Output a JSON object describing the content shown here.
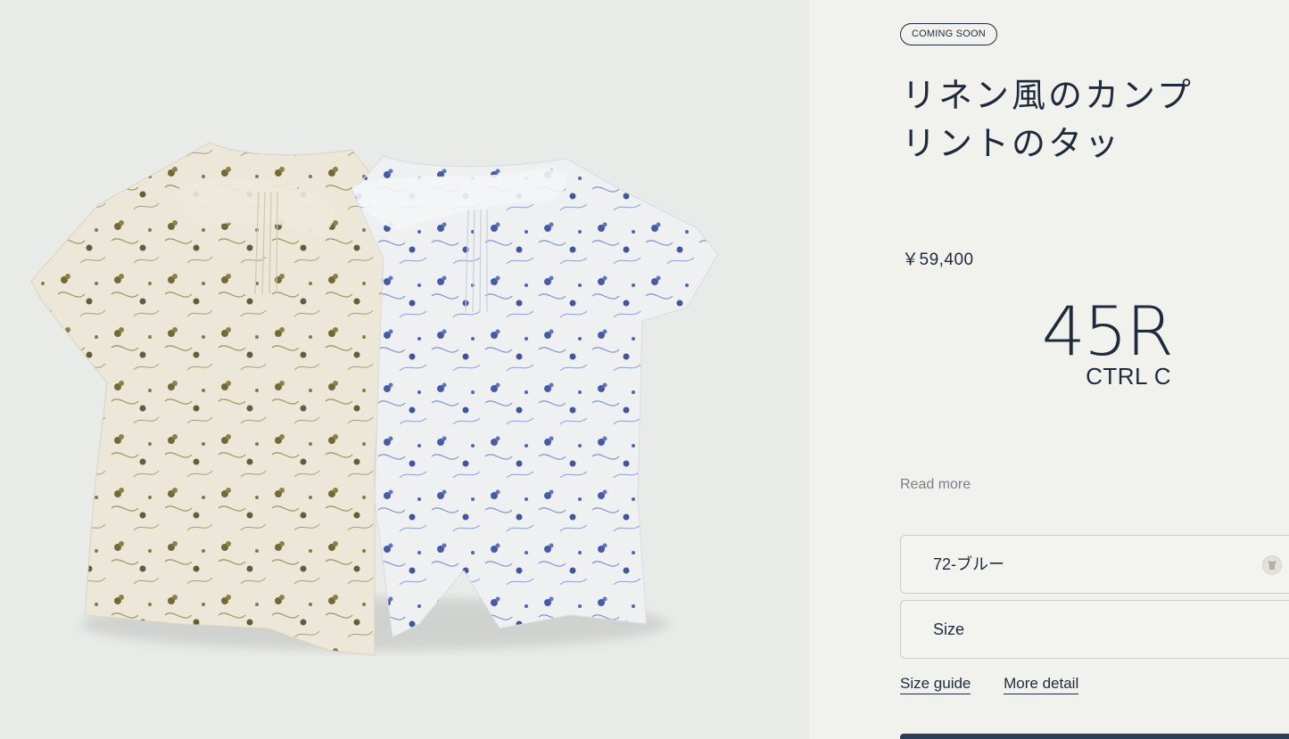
{
  "product": {
    "badge": "COMING SOON",
    "title": "リネン風のカンプリントのタッ",
    "price": "￥59,400"
  },
  "brand": {
    "mark": "45R",
    "sub": "CTRL C"
  },
  "actions": {
    "read_more": "Read more",
    "color_select_value": "72-ブルー",
    "size_select_label": "Size",
    "size_guide": "Size guide",
    "more_detail": "More detail"
  },
  "colors": {
    "ink": "#1f2a3c",
    "panel_bg": "#f1f1ee",
    "image_bg": "#e9ebe9",
    "muted_link": "#7a808a",
    "cta": "#2c3e55"
  },
  "icons": {
    "swatch": "garment-swatch-icon"
  }
}
